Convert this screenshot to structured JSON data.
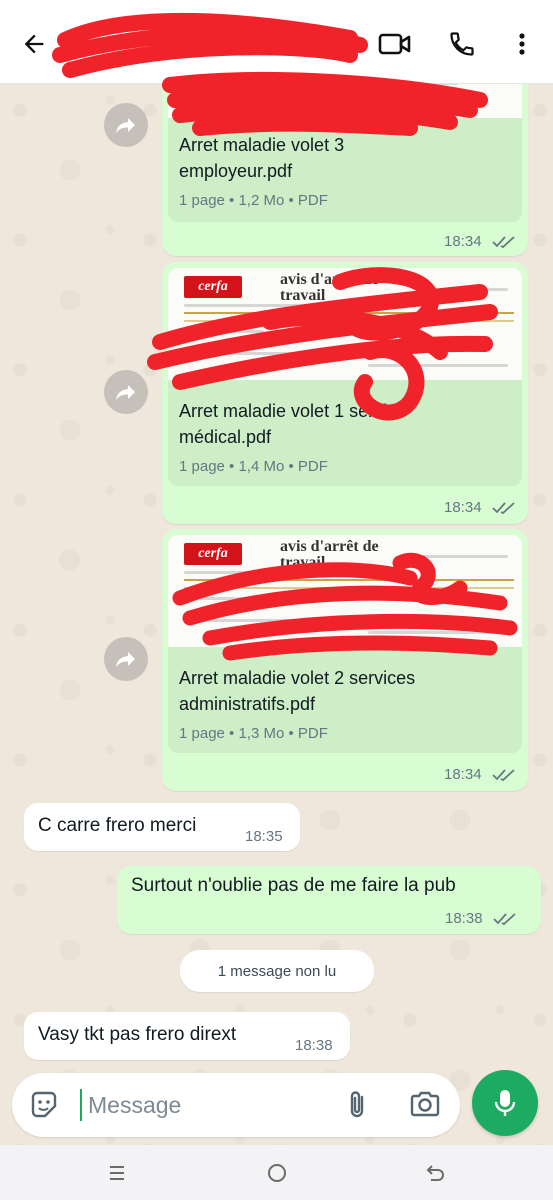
{
  "header": {
    "contact_name": "",
    "back_label": "Back",
    "video_label": "Video call",
    "call_label": "Voice call",
    "more_label": "More options"
  },
  "messages": [
    {
      "type": "document",
      "direction": "outgoing",
      "name": "Arret maladie volet 3 employeur.pdf",
      "name_lines": [
        "Arret maladie volet 3",
        "employeur.pdf"
      ],
      "meta": "1 page • 1,2 Mo • PDF",
      "time": "18:34",
      "status": "read"
    },
    {
      "type": "document",
      "direction": "outgoing",
      "name": "Arret maladie volet 1 service médical.pdf",
      "name_lines": [
        "Arret maladie volet 1 service",
        "médical.pdf"
      ],
      "meta": "1 page • 1,4 Mo • PDF",
      "time": "18:34",
      "status": "read",
      "preview": {
        "logo": "cerfa",
        "title": "avis d'arrêt de travail"
      }
    },
    {
      "type": "document",
      "direction": "outgoing",
      "name": "Arret maladie volet 2 services administratifs.pdf",
      "name_lines": [
        "Arret maladie volet 2 services",
        "administratifs.pdf"
      ],
      "meta": "1 page • 1,3 Mo • PDF",
      "time": "18:34",
      "status": "read",
      "preview": {
        "logo": "cerfa",
        "title": "avis d'arrêt de travail"
      }
    },
    {
      "type": "text",
      "direction": "incoming",
      "text": "C carre frero merci",
      "time": "18:35"
    },
    {
      "type": "text",
      "direction": "outgoing",
      "text": "Surtout n'oublie pas de me faire la pub",
      "time": "18:38",
      "status": "read"
    },
    {
      "type": "text",
      "direction": "incoming",
      "text": "Vasy tkt pas frero dirext",
      "time": "18:38"
    }
  ],
  "unread_divider": "1 message non lu",
  "composer": {
    "placeholder": "Message",
    "value": ""
  },
  "icons": {
    "back": "arrow-left-icon",
    "video": "video-camera-icon",
    "call": "phone-icon",
    "more": "more-vert-icon",
    "forward": "forward-icon",
    "ticks": "double-check-icon",
    "sticker": "sticker-icon",
    "attach": "paperclip-icon",
    "camera": "camera-icon",
    "mic": "microphone-icon",
    "nav_recents": "recents-icon",
    "nav_home": "home-icon",
    "nav_back": "nav-back-icon"
  },
  "colors": {
    "outgoing_bubble": "#d9fdd3",
    "incoming_bubble": "#ffffff",
    "accent_green": "#1daa61",
    "read_ticks": "#667781",
    "redaction": "#f0232b"
  }
}
